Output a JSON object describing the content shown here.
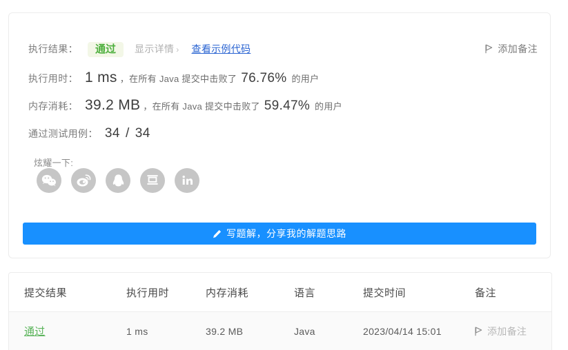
{
  "result_card": {
    "result_label": "执行结果：",
    "status_badge": "通过",
    "show_detail_link": "显示详情",
    "show_detail_chevron": "›",
    "sample_code_link": "查看示例代码",
    "add_note_label": "添加备注",
    "runtime": {
      "label": "执行用时：",
      "value": "1 ms",
      "beat_prefix": "，在所有 Java 提交中击败了",
      "percent": "76.76%",
      "beat_suffix": "的用户"
    },
    "memory": {
      "label": "内存消耗：",
      "value": "39.2 MB",
      "beat_prefix": "，在所有 Java 提交中击败了",
      "percent": "59.47%",
      "beat_suffix": "的用户"
    },
    "testcases": {
      "label": "通过测试用例：",
      "passed": "34",
      "separator": "/",
      "total": "34"
    },
    "share_label": "炫耀一下:",
    "share_icons": [
      {
        "name": "wechat-icon",
        "title": "微信"
      },
      {
        "name": "weibo-icon",
        "title": "微博"
      },
      {
        "name": "qq-icon",
        "title": "QQ"
      },
      {
        "name": "douban-icon",
        "title": "豆瓣"
      },
      {
        "name": "linkedin-icon",
        "title": "LinkedIn"
      }
    ],
    "cta_button": "写题解，分享我的解题思路",
    "cta_icon": "pencil-icon"
  },
  "submissions_table": {
    "columns": [
      "提交结果",
      "执行用时",
      "内存消耗",
      "语言",
      "提交时间",
      "备注"
    ],
    "rows": [
      {
        "status": "通过",
        "runtime": "1 ms",
        "memory": "39.2 MB",
        "language": "Java",
        "submit_time": "2023/04/14 15:01",
        "note": "添加备注"
      }
    ]
  },
  "colors": {
    "accent_blue": "#1890ff",
    "link_blue": "#2a64d2",
    "pass_green": "#4caf3c",
    "badge_bg": "#f3f7e7",
    "row_bg": "#fafafa"
  }
}
